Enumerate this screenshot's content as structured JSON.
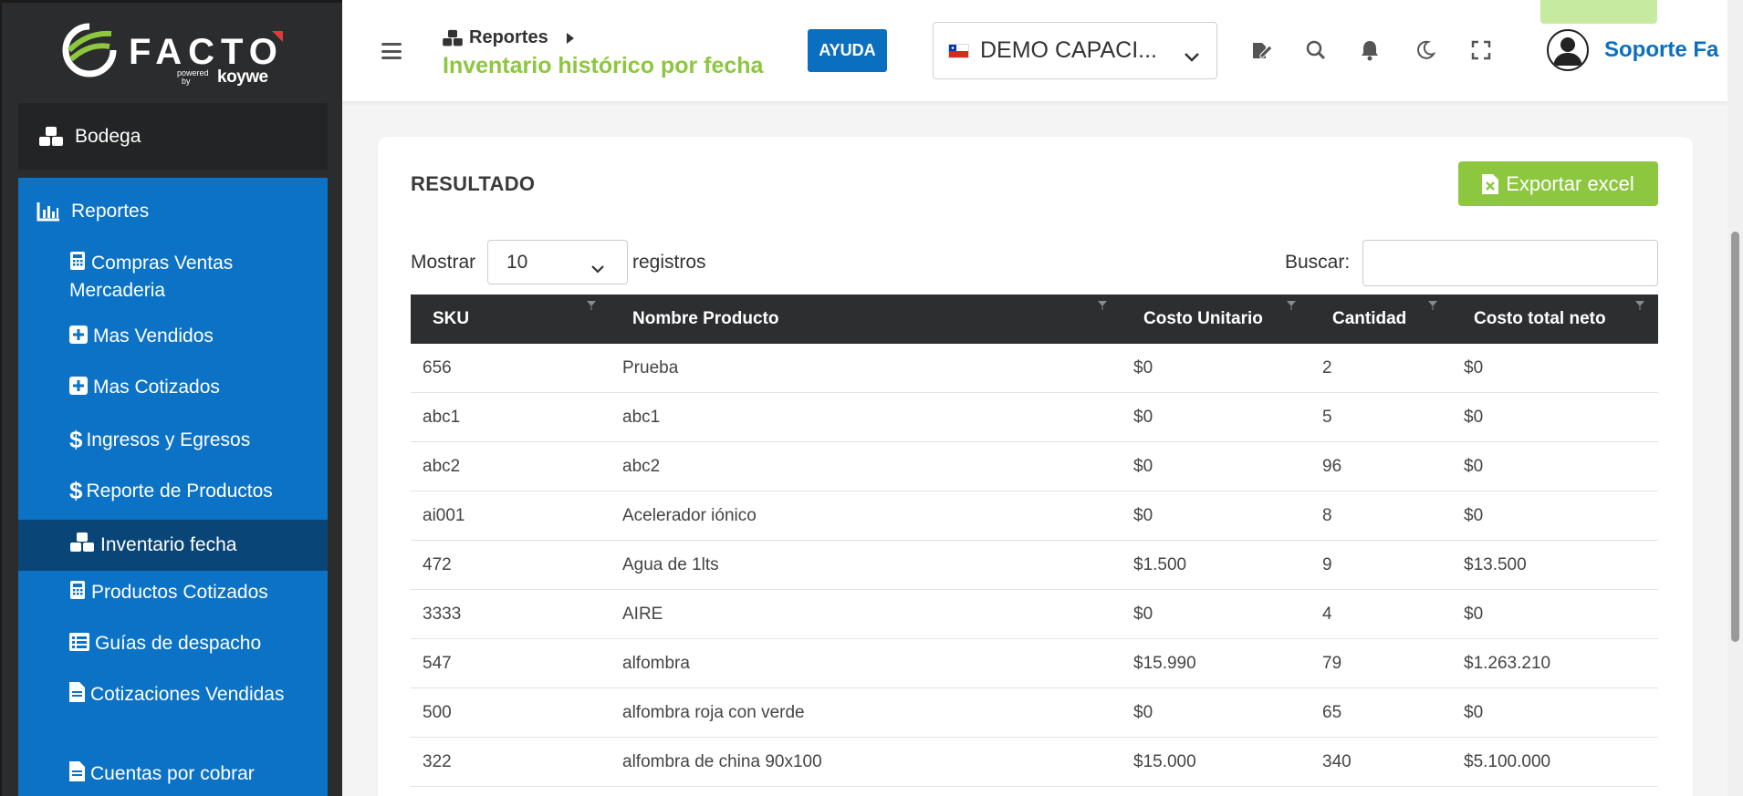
{
  "brand": {
    "logo_text": "FACTO",
    "powered_text": "powered\nby",
    "koywe_text": "koywe",
    "accent_green": "#8dc63f",
    "accent_blue": "#0c72c5"
  },
  "sidebar": {
    "section": "Bodega",
    "group": "Reportes",
    "items": [
      {
        "label": "Compras Ventas Mercaderia",
        "icon": "calculator-icon"
      },
      {
        "label": "Mas Vendidos",
        "icon": "plus-square-icon"
      },
      {
        "label": "Mas Cotizados",
        "icon": "plus-square-icon"
      },
      {
        "label": "Ingresos y Egresos",
        "icon": "dollar-icon"
      },
      {
        "label": "Reporte de Productos",
        "icon": "dollar-icon"
      },
      {
        "label": "Inventario fecha",
        "icon": "cubes-icon",
        "active": true
      },
      {
        "label": "Productos Cotizados",
        "icon": "calculator-icon"
      },
      {
        "label": "Guías de despacho",
        "icon": "table-list-icon"
      },
      {
        "label": "Cotizaciones Vendidas",
        "icon": "file-icon"
      },
      {
        "label": "Cuentas por cobrar",
        "icon": "file-icon"
      }
    ]
  },
  "header": {
    "breadcrumb": "Reportes",
    "title": "Inventario histórico por fecha",
    "help_label": "AYUDA",
    "company": "DEMO CAPACI...",
    "user": "Soporte Fa"
  },
  "main": {
    "card_title": "RESULTADO",
    "export_label": "Exportar excel",
    "show_label": "Mostrar",
    "page_size": "10",
    "records_label": "registros",
    "search_label": "Buscar:",
    "search_value": "",
    "columns": [
      "SKU",
      "Nombre Producto",
      "Costo Unitario",
      "Cantidad",
      "Costo total neto"
    ],
    "rows": [
      [
        "656",
        "Prueba",
        "$0",
        "2",
        "$0"
      ],
      [
        "abc1",
        "abc1",
        "$0",
        "5",
        "$0"
      ],
      [
        "abc2",
        "abc2",
        "$0",
        "96",
        "$0"
      ],
      [
        "ai001",
        "Acelerador iónico",
        "$0",
        "8",
        "$0"
      ],
      [
        "472",
        "Agua de 1lts",
        "$1.500",
        "9",
        "$13.500"
      ],
      [
        "3333",
        "AIRE",
        "$0",
        "4",
        "$0"
      ],
      [
        "547",
        "alfombra",
        "$15.990",
        "79",
        "$1.263.210"
      ],
      [
        "500",
        "alfombra roja con verde",
        "$0",
        "65",
        "$0"
      ],
      [
        "322",
        "alfombra de china 90x100",
        "$15.000",
        "340",
        "$5.100.000"
      ]
    ]
  }
}
